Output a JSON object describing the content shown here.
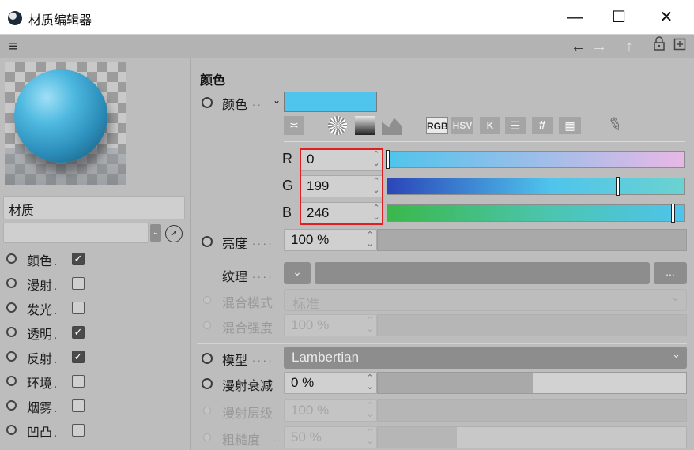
{
  "window": {
    "title": "材质编辑器",
    "minimize": "—",
    "maximize": "☐",
    "close": "✕"
  },
  "toolbar": {
    "menu_icon": "≡",
    "back_icon": "←",
    "forward_icon": "→",
    "up_icon": "↑",
    "lock_icon": "🔒",
    "new_icon": "⊞"
  },
  "left": {
    "material_name": "材质",
    "channels": [
      {
        "label": "颜色",
        "checked": true
      },
      {
        "label": "漫射",
        "checked": false
      },
      {
        "label": "发光",
        "checked": false
      },
      {
        "label": "透明",
        "checked": true
      },
      {
        "label": "反射",
        "checked": true
      },
      {
        "label": "环境",
        "checked": false
      },
      {
        "label": "烟雾",
        "checked": false
      },
      {
        "label": "凹凸",
        "checked": false
      }
    ]
  },
  "color": {
    "section_title": "颜色",
    "color_label": "颜色",
    "swatch_color": "#4fc4ec",
    "modes": {
      "rgb": "RGB",
      "hsv": "HSV",
      "k": "K",
      "hash": "#"
    },
    "r_label": "R",
    "r_value": "0",
    "g_label": "G",
    "g_value": "199",
    "b_label": "B",
    "b_value": "246",
    "brightness_label": "亮度",
    "brightness_value": "100 %",
    "texture_label": "纹理",
    "texture_more": "...",
    "blend_mode_label": "混合模式",
    "blend_mode_value": "标准",
    "blend_strength_label": "混合强度",
    "blend_strength_value": "100 %",
    "model_label": "模型",
    "model_value": "Lambertian",
    "diffuse_falloff_label": "漫射衰减",
    "diffuse_falloff_value": "0 %",
    "diffuse_level_label": "漫射层级",
    "diffuse_level_value": "100 %",
    "roughness_label": "粗糙度",
    "roughness_value": "50 %"
  }
}
